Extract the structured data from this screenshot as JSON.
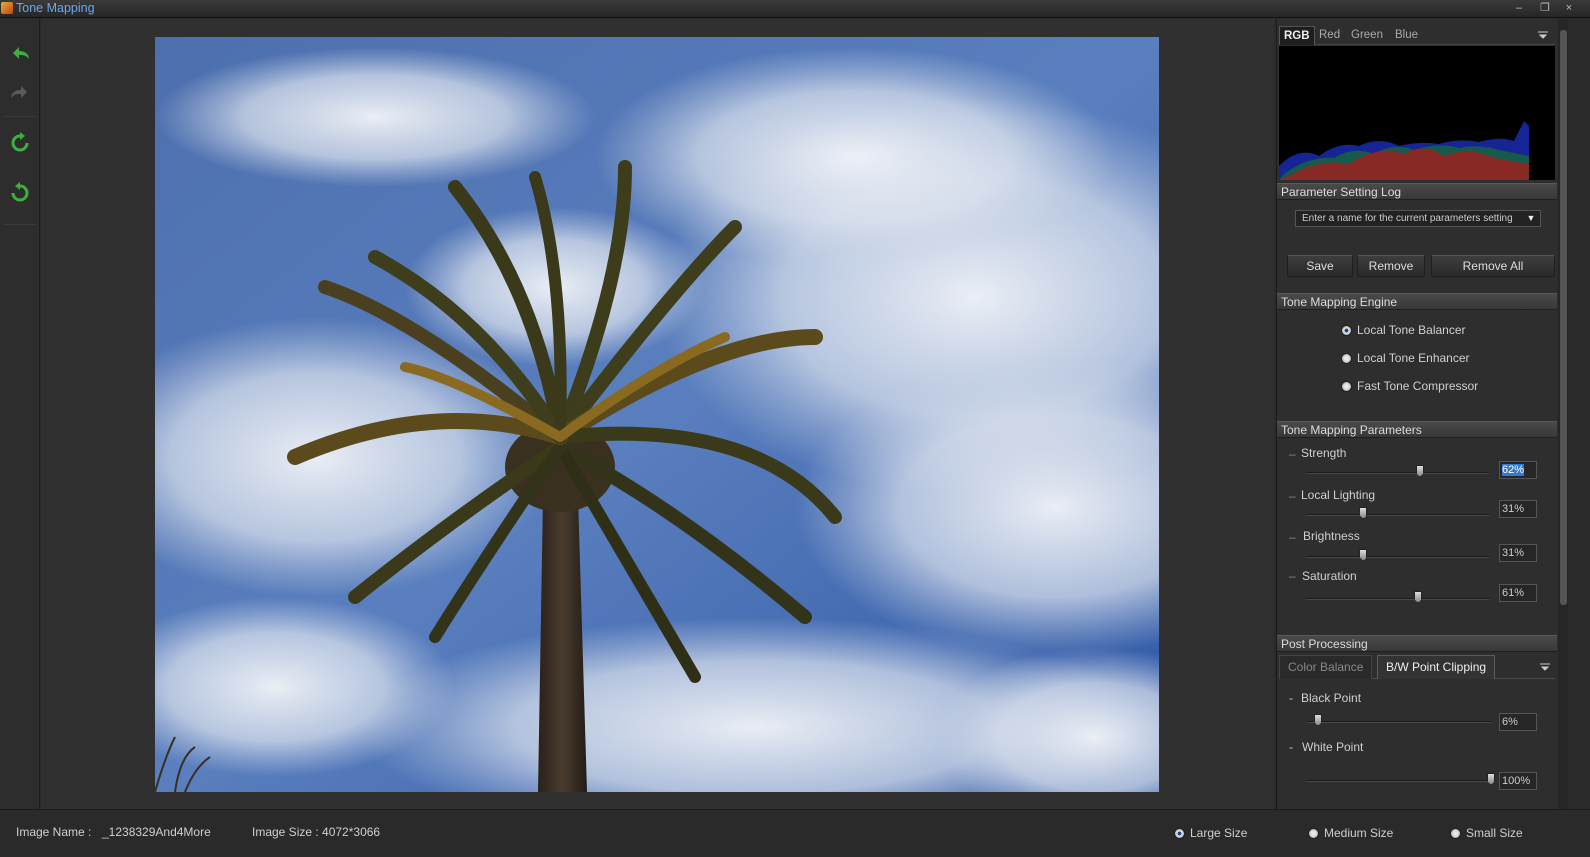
{
  "window": {
    "title": "Tone Mapping",
    "minimize": "–",
    "restore": "❐",
    "close": "×"
  },
  "toolbar": {
    "tools": [
      {
        "name": "undo-icon",
        "active": true
      },
      {
        "name": "redo-icon",
        "active": false
      },
      {
        "name": "rotate-right-icon",
        "active": true
      },
      {
        "name": "rotate-left-icon",
        "active": true
      }
    ]
  },
  "histogram": {
    "tabs": [
      "RGB",
      "Red",
      "Green",
      "Blue"
    ],
    "active_tab": "RGB",
    "menu_icon": "menu-icon"
  },
  "log": {
    "header": "Parameter Setting Log",
    "placeholder": "Enter a name for the current parameters setting",
    "save": "Save",
    "remove": "Remove",
    "remove_all": "Remove All"
  },
  "engine": {
    "header": "Tone Mapping Engine",
    "options": [
      "Local Tone Balancer",
      "Local Tone Enhancer",
      "Fast Tone Compressor"
    ],
    "selected": "Local Tone Balancer"
  },
  "params": {
    "header": "Tone Mapping Parameters",
    "items": [
      {
        "label": "Strength",
        "value": "62%",
        "level": 0.62
      },
      {
        "label": "Local Lighting",
        "value": "31%",
        "level": 0.31
      },
      {
        "label": "Brightness",
        "value": "31%",
        "level": 0.31
      },
      {
        "label": "Saturation",
        "value": "61%",
        "level": 0.61
      }
    ]
  },
  "post": {
    "header": "Post Processing",
    "tabs": [
      "Color Balance",
      "B/W Point Clipping"
    ],
    "active_tab": "B/W Point Clipping",
    "items": [
      {
        "label": "Black Point",
        "value": "6%",
        "level": 0.06
      },
      {
        "label": "White Point",
        "value": "100%",
        "level": 1.0
      }
    ]
  },
  "status": {
    "image_name_label": "Image Name :",
    "image_name": "_1238329And4More",
    "image_size": "Image Size : 4072*3066",
    "sizes": [
      "Large Size",
      "Medium Size",
      "Small Size"
    ],
    "selected_size": "Large Size"
  },
  "colors": {
    "accent": "#3478d8",
    "tool_green": "#3fae3f",
    "title_blue": "#6aa8e8"
  }
}
